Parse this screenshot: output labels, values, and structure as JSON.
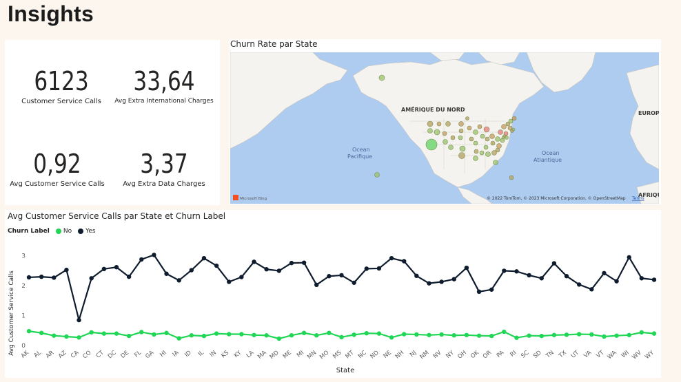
{
  "page": {
    "title": "Insights"
  },
  "kpis": [
    {
      "value": "6123",
      "label": "Customer Service Calls"
    },
    {
      "value": "33,64",
      "label": "Avg Extra International Charges"
    },
    {
      "value": "0,92",
      "label": "Avg Customer Service Calls"
    },
    {
      "value": "3,37",
      "label": "Avg Extra Data Charges"
    }
  ],
  "map": {
    "title": "Churn Rate par State",
    "labels": {
      "continent": "AMÉRIQUE DU NORD",
      "pacific": "Ocean Pacifique",
      "atlantic": "Ocean Atlantique",
      "europe": "EUROPE",
      "africa": "AFRIQUE"
    },
    "logo": "Microsoft Bing",
    "attribution": "© 2022 TomTom, © 2023 Microsoft Corporation, © OpenStreetMap",
    "terms": "Terms",
    "colors": {
      "ocean": "#aecbf0",
      "land": "#f4f3ef",
      "bubble_low": "#9bc36b",
      "bubble_mid": "#c89a5e",
      "bubble_high": "#e8797b",
      "bubble_green": "#5fd35f"
    }
  },
  "line_chart": {
    "title": "Avg Customer Service Calls par State et Churn Label",
    "legend_title": "Churn Label",
    "colors": {
      "No": "#1fd655",
      "Yes": "#0f1c2e"
    }
  },
  "chart_data": {
    "type": "line",
    "title": "Avg Customer Service Calls par State et Churn Label",
    "xlabel": "State",
    "ylabel": "Avg Customer Service Calls",
    "ylim": [
      0,
      3.2
    ],
    "yticks": [
      0,
      1,
      2,
      3
    ],
    "grid": false,
    "legend": "top-left",
    "categories": [
      "AK",
      "AL",
      "AR",
      "AZ",
      "CA",
      "CO",
      "CT",
      "DC",
      "DE",
      "FL",
      "GA",
      "HI",
      "IA",
      "ID",
      "IL",
      "IN",
      "KS",
      "KY",
      "LA",
      "MA",
      "MD",
      "ME",
      "MI",
      "MN",
      "MO",
      "MS",
      "MT",
      "NC",
      "ND",
      "NE",
      "NH",
      "NJ",
      "NM",
      "NV",
      "NY",
      "OH",
      "OK",
      "OR",
      "PA",
      "RI",
      "SC",
      "SD",
      "TN",
      "TX",
      "UT",
      "VA",
      "VT",
      "WA",
      "WI",
      "WV",
      "WY"
    ],
    "series": [
      {
        "name": "No",
        "values": [
          0.48,
          0.42,
          0.33,
          0.3,
          0.27,
          0.44,
          0.4,
          0.4,
          0.32,
          0.45,
          0.37,
          0.42,
          0.24,
          0.34,
          0.32,
          0.4,
          0.38,
          0.38,
          0.35,
          0.34,
          0.23,
          0.34,
          0.42,
          0.34,
          0.42,
          0.28,
          0.36,
          0.41,
          0.4,
          0.27,
          0.38,
          0.37,
          0.35,
          0.37,
          0.34,
          0.35,
          0.33,
          0.32,
          0.46,
          0.26,
          0.33,
          0.32,
          0.35,
          0.36,
          0.38,
          0.37,
          0.3,
          0.33,
          0.35,
          0.44,
          0.4
        ]
      },
      {
        "name": "Yes",
        "values": [
          2.28,
          2.3,
          2.27,
          2.53,
          0.85,
          2.25,
          2.56,
          2.62,
          2.3,
          2.88,
          3.03,
          2.4,
          2.18,
          2.52,
          2.92,
          2.67,
          2.13,
          2.29,
          2.8,
          2.55,
          2.5,
          2.76,
          2.77,
          2.03,
          2.32,
          2.35,
          2.1,
          2.57,
          2.58,
          2.92,
          2.82,
          2.33,
          2.08,
          2.13,
          2.22,
          2.6,
          1.8,
          1.87,
          2.5,
          2.48,
          2.35,
          2.25,
          2.75,
          2.32,
          2.04,
          1.88,
          2.42,
          2.15,
          2.95,
          2.25,
          2.2
        ]
      }
    ]
  }
}
